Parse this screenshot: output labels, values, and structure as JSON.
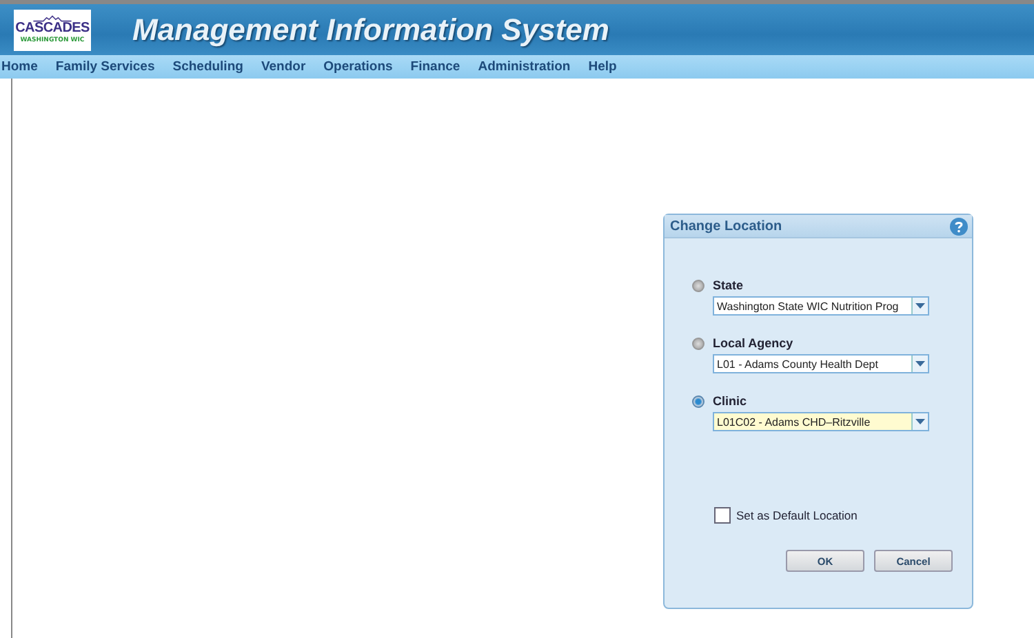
{
  "header": {
    "logo_title": "CASCADES",
    "logo_subtitle": "WASHINGTON WIC",
    "title": "Management Information System"
  },
  "menu": [
    "Home",
    "Family Services",
    "Scheduling",
    "Vendor",
    "Operations",
    "Finance",
    "Administration",
    "Help"
  ],
  "dialog": {
    "title": "Change Location",
    "options": [
      {
        "label": "State",
        "value": "Washington State WIC Nutrition Prog",
        "selected": false
      },
      {
        "label": "Local Agency",
        "value": "L01 - Adams County Health Dept",
        "selected": false
      },
      {
        "label": "Clinic",
        "value": "L01C02 - Adams CHD–Ritzville",
        "selected": true
      }
    ],
    "default_checkbox": {
      "label": "Set as Default Location",
      "checked": false
    },
    "buttons": [
      "OK",
      "Cancel"
    ]
  }
}
